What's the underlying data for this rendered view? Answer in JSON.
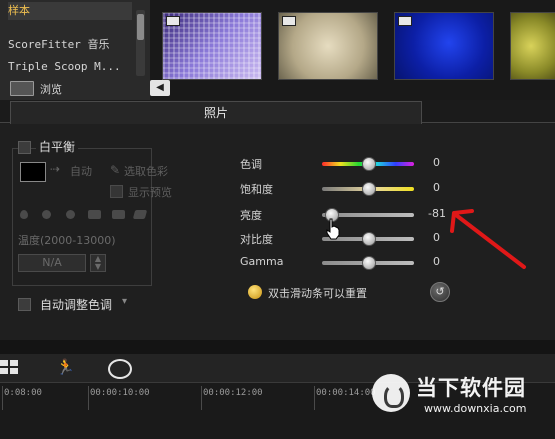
{
  "library": {
    "items": [
      "样本",
      "ScoreFitter 音乐",
      "Triple Scoop M..."
    ],
    "browse_label": "浏览"
  },
  "thumbnails": [
    "purple-mosaic",
    "beige-texture",
    "blue-texture",
    "yellow-green-texture"
  ],
  "tab": {
    "label": "照片"
  },
  "white_balance": {
    "title": "白平衡",
    "auto_label": "自动",
    "select_color_label": "选取色彩",
    "show_preview_label": "显示预览",
    "temperature_label": "温度(2000-13000)",
    "temperature_value": "N/A"
  },
  "auto_tone": {
    "label": "自动调整色调"
  },
  "adjustments": [
    {
      "label": "色调",
      "value": "0",
      "level": 0.5
    },
    {
      "label": "饱和度",
      "value": "0",
      "level": 0.5
    },
    {
      "label": "亮度",
      "value": "-81",
      "level": 0.095
    },
    {
      "label": "对比度",
      "value": "0",
      "level": 0.5
    },
    {
      "label": "Gamma",
      "value": "0",
      "level": 0.5
    }
  ],
  "hint": {
    "text": "双击滑动条可以重置"
  },
  "timeline": {
    "ticks": [
      "0:08:00",
      "00:00:10:00",
      "00:00:12:00",
      "00:00:14:00"
    ]
  },
  "watermark": {
    "name": "当下软件园",
    "url": "www.downxia.com"
  },
  "colors": {
    "annotation_arrow": "#e01818",
    "panel_bg": "#1f1f1f"
  }
}
